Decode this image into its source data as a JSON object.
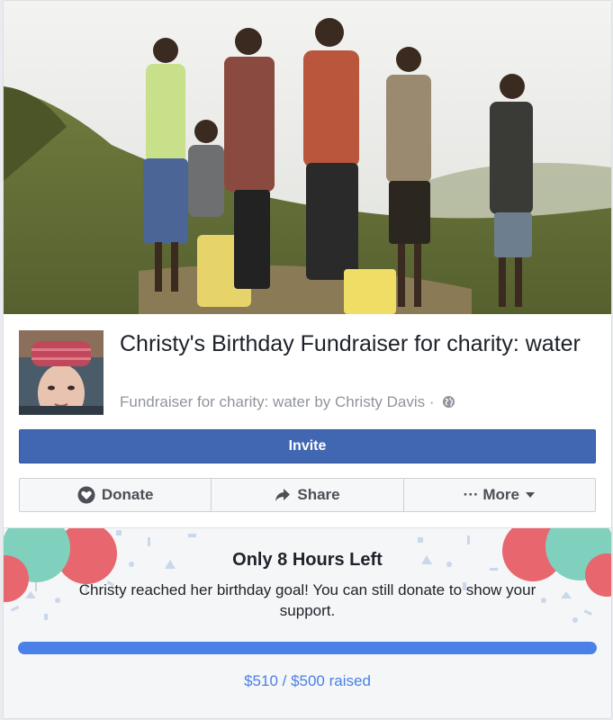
{
  "fundraiser": {
    "title": "Christy's Birthday Fundraiser for charity: water",
    "subtitle": "Fundraiser for charity: water by Christy Davis ·"
  },
  "buttons": {
    "invite": "Invite",
    "donate": "Donate",
    "share": "Share",
    "more": "··· More"
  },
  "goal_panel": {
    "title": "Only 8 Hours Left",
    "message": "Christy reached her birthday goal! You can still donate to show your support.",
    "raised_text": "$510 / $500 raised",
    "progress_fraction": 1.0
  },
  "colors": {
    "brand_blue": "#4267b2",
    "progress_blue": "#4a80e8",
    "balloon_red": "#e8666e",
    "balloon_teal": "#7fd0bd"
  },
  "icons": [
    "globe-icon",
    "donate-heart-icon",
    "share-arrow-icon",
    "caret-down-icon"
  ]
}
